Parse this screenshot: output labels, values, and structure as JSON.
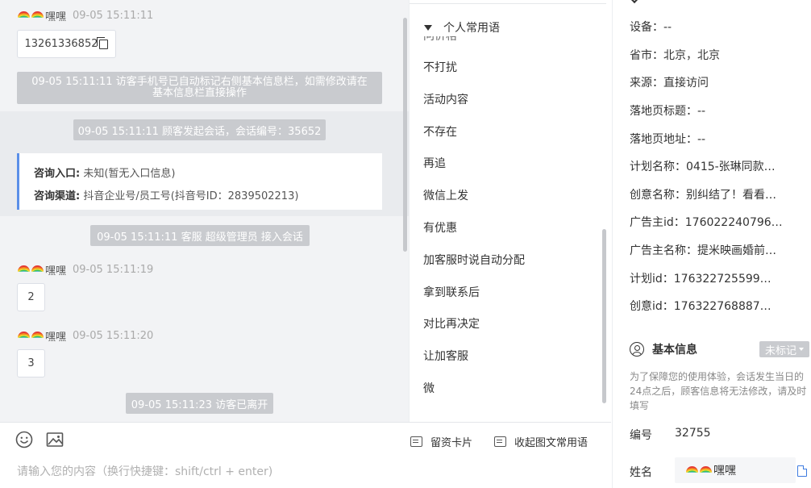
{
  "chat": {
    "messages": [
      {
        "kind": "visitor",
        "name": "嘿嘿",
        "time": "09-05 15:11:11",
        "text": "13261336852"
      },
      {
        "kind": "system",
        "text": "09-05 15:11:11 访客手机号已自动标记右侧基本信息栏，如需修改请在基本信息栏直接操作"
      },
      {
        "kind": "system",
        "text": "09-05 15:11:11 顾客发起会话，会话编号：35652"
      },
      {
        "kind": "system",
        "text": "09-05 15:11:11 客服 超级管理员 接入会话"
      },
      {
        "kind": "visitor",
        "name": "嘿嘿",
        "time": "09-05 15:11:19",
        "text": "2"
      },
      {
        "kind": "visitor",
        "name": "嘿嘿",
        "time": "09-05 15:11:20",
        "text": "3"
      },
      {
        "kind": "system",
        "text": "09-05 15:11:23 访客已离开"
      }
    ],
    "consult_card": {
      "entry_label": "咨询入口:",
      "entry_value": "未知(暂无入口信息)",
      "channel_label": "咨询渠道:",
      "channel_value": "抖音企业号/员工号(抖音号ID：2839502213)"
    }
  },
  "input": {
    "placeholder": "请输入您的内容（换行快捷键：shift/ctrl + enter)",
    "card_button": "留资卡片",
    "collapse_button": "收起图文常用语",
    "icons": [
      "emoji-icon",
      "image-icon"
    ]
  },
  "phrases": {
    "header": "个人常用语",
    "cut_item": "问价格",
    "items": [
      "不打扰",
      "活动内容",
      "不存在",
      "再追",
      "微信上发",
      "有优惠",
      "加客服时说自动分配",
      "拿到联系后",
      "对比再决定",
      "让加客服",
      "微"
    ]
  },
  "info": {
    "rows": [
      "设备：--",
      "省市：北京，北京",
      "来源：直接访问",
      "落地页标题：--",
      "落地页地址：--",
      "计划名称：0415-张琳同款…",
      "创意名称：别纠结了！看看…",
      "广告主id：176022240796…",
      "广告主名称：提米映画婚前…",
      "计划id：176322725599…",
      "创意id：176322768887…"
    ],
    "basic_title": "基本信息",
    "mark_badge": "未标记",
    "basic_note": "为了保障您的使用体验，会话发生当日的24点之后，顾客信息将无法修改，请及时填写",
    "number_label": "编号",
    "number_value": "32755",
    "name_label": "姓名",
    "name_value": "嘿嘿"
  },
  "colors": {
    "accent_blue": "#5b8fe8",
    "system_pill": "#c9cbcf",
    "chat_bg": "#f2f3f5"
  }
}
